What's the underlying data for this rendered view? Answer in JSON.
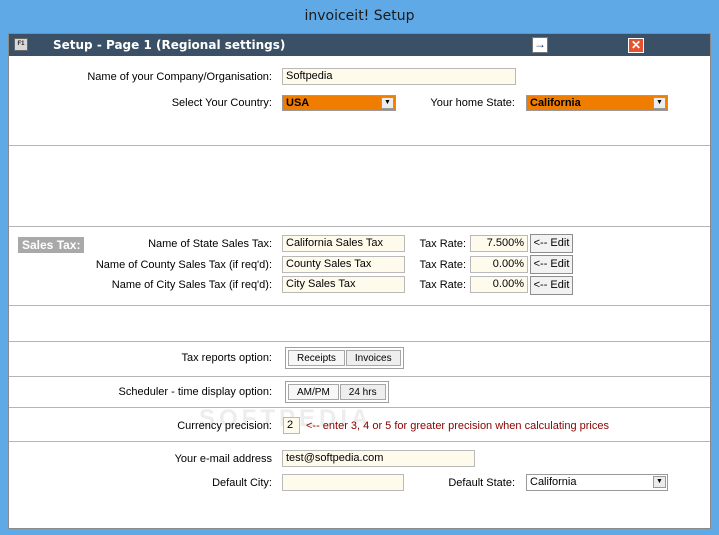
{
  "window": {
    "title": "invoiceit! Setup"
  },
  "header": {
    "f_button": "F1",
    "title": "Setup - Page 1 (Regional settings)",
    "next_glyph": "→",
    "close_glyph": "✕"
  },
  "company": {
    "label": "Name of your Company/Organisation:",
    "value": "Softpedia"
  },
  "country": {
    "label": "Select Your Country:",
    "value": "USA"
  },
  "home_state": {
    "label": "Your home State:",
    "value": "California"
  },
  "sales_tax": {
    "badge": "Sales Tax:",
    "tax_rate_label": "Tax Rate:",
    "edit_label": "<-- Edit",
    "rows": [
      {
        "label": "Name of State Sales Tax:",
        "name": "California Sales Tax",
        "rate": "7.500%"
      },
      {
        "label": "Name of County Sales Tax (if req'd):",
        "name": "County Sales Tax",
        "rate": "0.00%"
      },
      {
        "label": "Name of City Sales Tax (if req'd):",
        "name": "City Sales Tax",
        "rate": "0.00%"
      }
    ]
  },
  "tax_reports": {
    "label": "Tax reports option:",
    "options": [
      "Receipts",
      "Invoices"
    ]
  },
  "scheduler": {
    "label": "Scheduler - time display option:",
    "options": [
      "AM/PM",
      "24 hrs"
    ]
  },
  "currency": {
    "label": "Currency precision:",
    "value": "2",
    "hint": "<-- enter 3, 4 or 5 for greater precision when calculating prices"
  },
  "email": {
    "label": "Your e-mail address",
    "value": "test@softpedia.com"
  },
  "default_city": {
    "label": "Default City:",
    "value": ""
  },
  "default_state": {
    "label": "Default State:",
    "value": "California"
  },
  "watermark": "SOFTPEDIA",
  "colors": {
    "titlebar": "#5fa9e6",
    "header": "#3a5066",
    "accent_select": "#f07d00",
    "badge": "#a9a9a9",
    "hint": "#8b0000"
  }
}
